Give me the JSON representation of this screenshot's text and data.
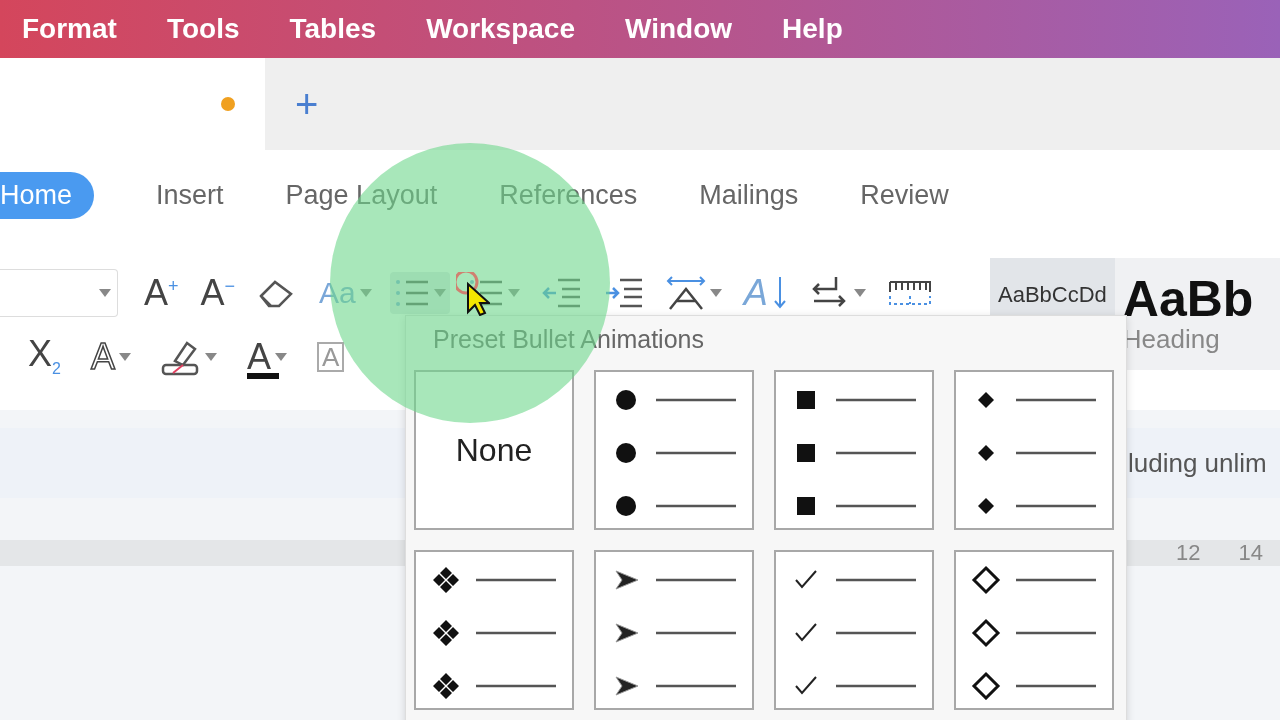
{
  "menu_bar": [
    "Format",
    "Tools",
    "Tables",
    "Workspace",
    "Window",
    "Help"
  ],
  "document_tab": {
    "modified": true
  },
  "new_tab_button": "+",
  "ribbon_tabs": [
    {
      "label": "Home",
      "selected": true
    },
    {
      "label": "Insert",
      "selected": false
    },
    {
      "label": "Page Layout",
      "selected": false
    },
    {
      "label": "References",
      "selected": false
    },
    {
      "label": "Mailings",
      "selected": false
    },
    {
      "label": "Review",
      "selected": false
    }
  ],
  "toolbar_rows": [
    [
      {
        "kind": "font-size",
        "dropdown": true
      },
      {
        "kind": "text",
        "label": "A$^{+}$"
      },
      {
        "kind": "text",
        "label": "A$^{−}$"
      },
      {
        "kind": "eraser"
      },
      {
        "kind": "case",
        "label": "Aa",
        "dropdown": true
      },
      {
        "kind": "bullets",
        "active": true,
        "dropdown": true
      },
      {
        "kind": "numbering",
        "dropdown": true
      },
      {
        "kind": "outdent"
      },
      {
        "kind": "indent"
      },
      {
        "kind": "direction",
        "dropdown": true
      },
      {
        "kind": "sort",
        "label": "A"
      },
      {
        "kind": "linebreak",
        "dropdown": true
      },
      {
        "kind": "ruler"
      }
    ],
    [
      {
        "kind": "subscript",
        "label": "X$_{2}$"
      },
      {
        "kind": "effect",
        "label": "A",
        "dropdown": true
      },
      {
        "kind": "highlighter",
        "dropdown": true
      },
      {
        "kind": "color",
        "label": "A",
        "dropdown": true
      },
      {
        "kind": "border",
        "label": "A"
      }
    ]
  ],
  "style_gallery": [
    {
      "sample": "AaBbCcDd",
      "selected": true
    },
    {
      "sample": "AaBb",
      "name": "Heading",
      "selected": false
    }
  ],
  "document_text": "luding unlim",
  "ruler_numbers": [
    "12",
    "14"
  ],
  "bullet_menu": {
    "title": "Preset Bullet Animations",
    "options": [
      {
        "kind": "none",
        "label": "None"
      },
      {
        "kind": "dot"
      },
      {
        "kind": "square"
      },
      {
        "kind": "diamond"
      },
      {
        "kind": "quad-diamond"
      },
      {
        "kind": "arrowhead"
      },
      {
        "kind": "check"
      },
      {
        "kind": "hollow-diamond"
      }
    ]
  }
}
